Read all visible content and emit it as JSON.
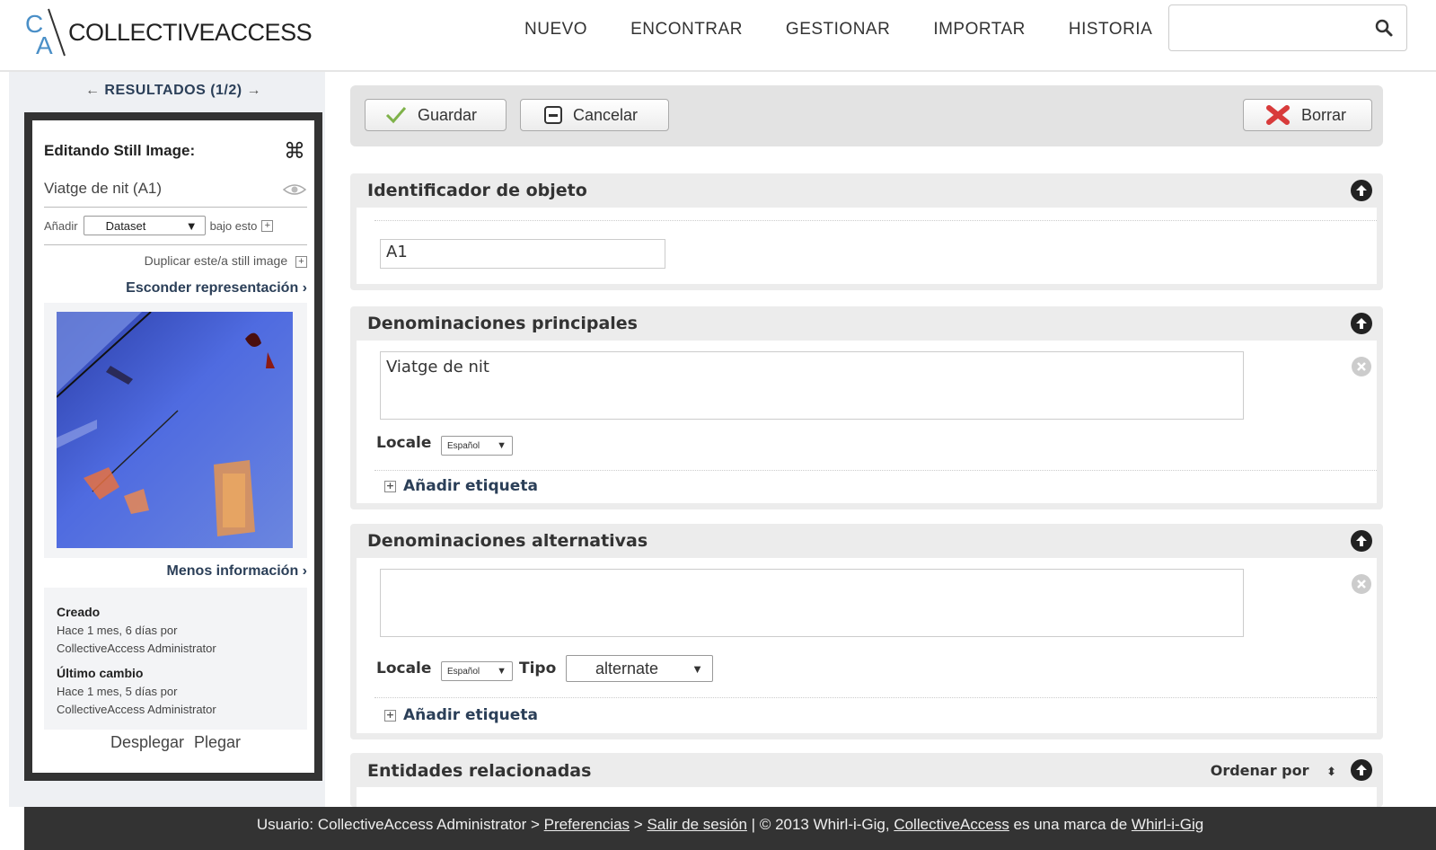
{
  "header": {
    "logo_text": "COLLECTIVEACCESS",
    "logo_letters": [
      "C",
      "A"
    ],
    "nav": [
      "NUEVO",
      "ENCONTRAR",
      "GESTIONAR",
      "IMPORTAR",
      "HISTORIA"
    ],
    "search_value": ""
  },
  "sidebar": {
    "results_label": "RESULTADOS (1/2)",
    "prev_arrow": "←",
    "next_arrow": "→",
    "editing_title": "Editando Still Image:",
    "object_name": "Viatge de nit (A1)",
    "add_label": "Añadir",
    "add_select_value": "Dataset",
    "add_suffix": "bajo esto",
    "duplicate_label": "Duplicar este/a still image",
    "hide_representation": "Esconder representación ›",
    "less_info": "Menos información ›",
    "created_label": "Creado",
    "created_line1": "Hace 1 mes, 6 días por",
    "created_line2": "CollectiveAccess Administrator",
    "changed_label": "Último cambio",
    "changed_line1": "Hace 1 mes, 5 días por",
    "changed_line2": "CollectiveAccess Administrator",
    "expand": "Desplegar",
    "collapse": "Plegar"
  },
  "toolbar": {
    "save": "Guardar",
    "cancel": "Cancelar",
    "delete": "Borrar"
  },
  "panels": {
    "identifier": {
      "title": "Identificador de objeto",
      "value": "A1"
    },
    "preferred": {
      "title": "Denominaciones principales",
      "value": "Viatge de nit",
      "locale_label": "Locale",
      "locale_value": "Español",
      "add_label": "Añadir etiqueta"
    },
    "alternate": {
      "title": "Denominaciones alternativas",
      "value": "",
      "locale_label": "Locale",
      "locale_value": "Español",
      "type_label": "Tipo",
      "type_value": "alternate",
      "add_label": "Añadir etiqueta"
    },
    "entities": {
      "title": "Entidades relacionadas",
      "sort_label": "Ordenar por"
    }
  },
  "footer": {
    "user_prefix": "Usuario: CollectiveAccess Administrator > ",
    "preferences": "Preferencias",
    "sep1": " > ",
    "logout": "Salir de sesión",
    "sep2": "  |  © 2013 Whirl-i-Gig, ",
    "ca_link": "CollectiveAccess",
    "sep3": " es una marca de ",
    "wig_link": "Whirl-i-Gig"
  },
  "colors": {
    "link_blue": "#2b3f58",
    "footer_bg": "#333333",
    "panel_bg": "#ececec"
  }
}
